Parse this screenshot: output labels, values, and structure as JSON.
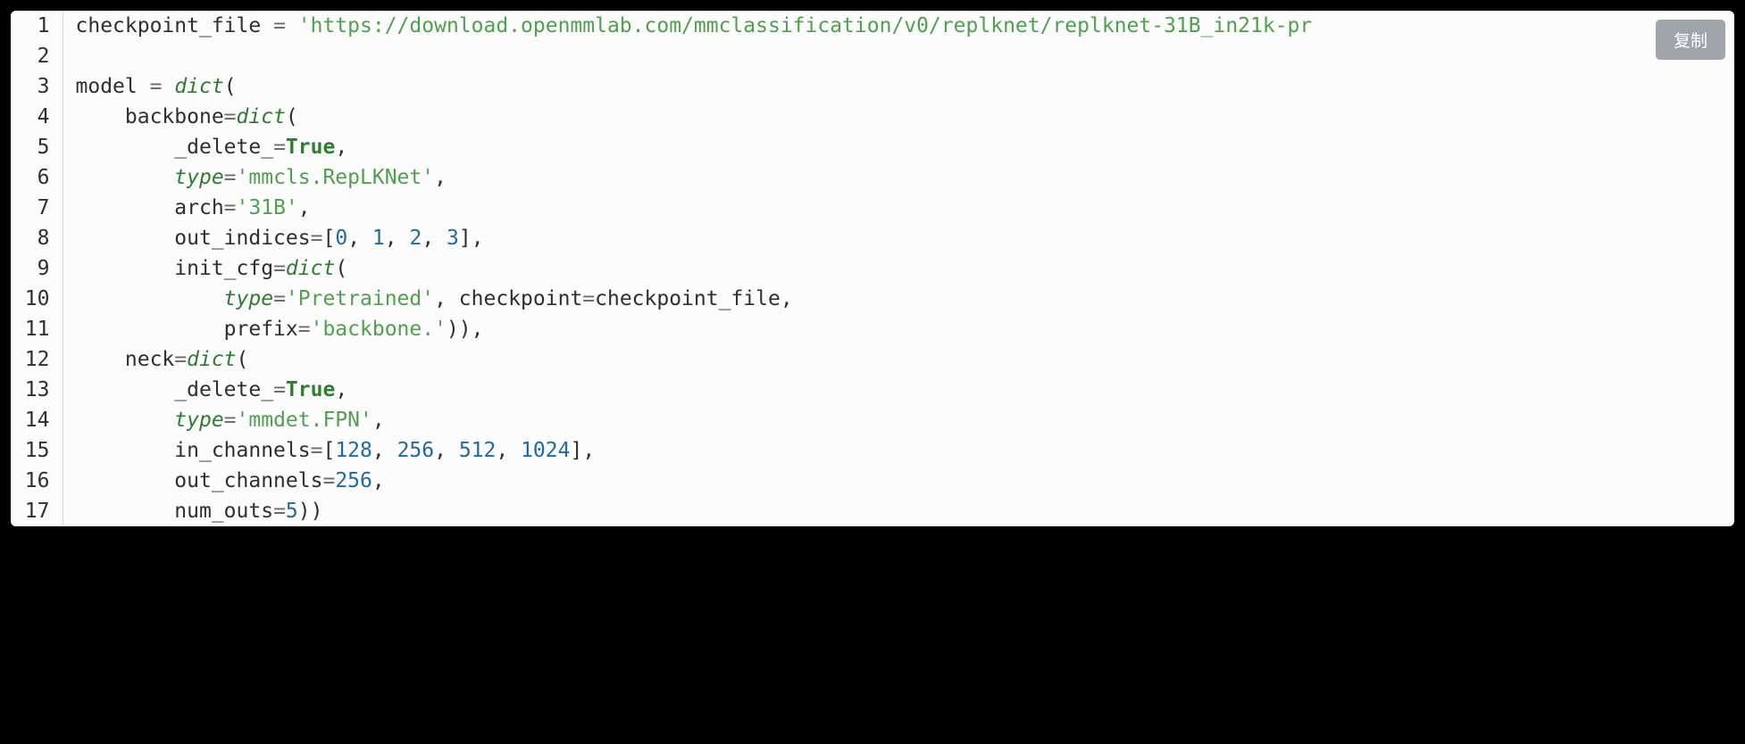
{
  "copy_button_label": "复制",
  "code": {
    "lines": [
      {
        "num": "1",
        "segments": [
          {
            "t": "checkpoint_file ",
            "c": "tok-name"
          },
          {
            "t": "=",
            "c": "tok-op"
          },
          {
            "t": " ",
            "c": ""
          },
          {
            "t": "'https://download.openmmlab.com/mmclassification/v0/replknet/replknet-31B_in21k-pr",
            "c": "tok-str"
          }
        ]
      },
      {
        "num": "2",
        "segments": [
          {
            "t": "",
            "c": ""
          }
        ]
      },
      {
        "num": "3",
        "segments": [
          {
            "t": "model ",
            "c": "tok-name"
          },
          {
            "t": "=",
            "c": "tok-op"
          },
          {
            "t": " ",
            "c": ""
          },
          {
            "t": "dict",
            "c": "tok-builtin"
          },
          {
            "t": "(",
            "c": "tok-punct"
          }
        ]
      },
      {
        "num": "4",
        "segments": [
          {
            "t": "    backbone",
            "c": "tok-name"
          },
          {
            "t": "=",
            "c": "tok-op"
          },
          {
            "t": "dict",
            "c": "tok-builtin"
          },
          {
            "t": "(",
            "c": "tok-punct"
          }
        ]
      },
      {
        "num": "5",
        "segments": [
          {
            "t": "        _delete_",
            "c": "tok-name"
          },
          {
            "t": "=",
            "c": "tok-op"
          },
          {
            "t": "True",
            "c": "tok-kw"
          },
          {
            "t": ",",
            "c": "tok-punct"
          }
        ]
      },
      {
        "num": "6",
        "segments": [
          {
            "t": "        ",
            "c": ""
          },
          {
            "t": "type",
            "c": "tok-builtin"
          },
          {
            "t": "=",
            "c": "tok-op"
          },
          {
            "t": "'mmcls.RepLKNet'",
            "c": "tok-str"
          },
          {
            "t": ",",
            "c": "tok-punct"
          }
        ]
      },
      {
        "num": "7",
        "segments": [
          {
            "t": "        arch",
            "c": "tok-name"
          },
          {
            "t": "=",
            "c": "tok-op"
          },
          {
            "t": "'31B'",
            "c": "tok-str"
          },
          {
            "t": ",",
            "c": "tok-punct"
          }
        ]
      },
      {
        "num": "8",
        "segments": [
          {
            "t": "        out_indices",
            "c": "tok-name"
          },
          {
            "t": "=",
            "c": "tok-op"
          },
          {
            "t": "[",
            "c": "tok-punct"
          },
          {
            "t": "0",
            "c": "tok-num"
          },
          {
            "t": ", ",
            "c": "tok-punct"
          },
          {
            "t": "1",
            "c": "tok-num"
          },
          {
            "t": ", ",
            "c": "tok-punct"
          },
          {
            "t": "2",
            "c": "tok-num"
          },
          {
            "t": ", ",
            "c": "tok-punct"
          },
          {
            "t": "3",
            "c": "tok-num"
          },
          {
            "t": "],",
            "c": "tok-punct"
          }
        ]
      },
      {
        "num": "9",
        "segments": [
          {
            "t": "        init_cfg",
            "c": "tok-name"
          },
          {
            "t": "=",
            "c": "tok-op"
          },
          {
            "t": "dict",
            "c": "tok-builtin"
          },
          {
            "t": "(",
            "c": "tok-punct"
          }
        ]
      },
      {
        "num": "10",
        "segments": [
          {
            "t": "            ",
            "c": ""
          },
          {
            "t": "type",
            "c": "tok-builtin"
          },
          {
            "t": "=",
            "c": "tok-op"
          },
          {
            "t": "'Pretrained'",
            "c": "tok-str"
          },
          {
            "t": ", checkpoint",
            "c": "tok-name"
          },
          {
            "t": "=",
            "c": "tok-op"
          },
          {
            "t": "checkpoint_file,",
            "c": "tok-name"
          }
        ]
      },
      {
        "num": "11",
        "segments": [
          {
            "t": "            prefix",
            "c": "tok-name"
          },
          {
            "t": "=",
            "c": "tok-op"
          },
          {
            "t": "'backbone.'",
            "c": "tok-str"
          },
          {
            "t": ")),",
            "c": "tok-punct"
          }
        ]
      },
      {
        "num": "12",
        "segments": [
          {
            "t": "    neck",
            "c": "tok-name"
          },
          {
            "t": "=",
            "c": "tok-op"
          },
          {
            "t": "dict",
            "c": "tok-builtin"
          },
          {
            "t": "(",
            "c": "tok-punct"
          }
        ]
      },
      {
        "num": "13",
        "segments": [
          {
            "t": "        _delete_",
            "c": "tok-name"
          },
          {
            "t": "=",
            "c": "tok-op"
          },
          {
            "t": "True",
            "c": "tok-kw"
          },
          {
            "t": ",",
            "c": "tok-punct"
          }
        ]
      },
      {
        "num": "14",
        "segments": [
          {
            "t": "        ",
            "c": ""
          },
          {
            "t": "type",
            "c": "tok-builtin"
          },
          {
            "t": "=",
            "c": "tok-op"
          },
          {
            "t": "'mmdet.FPN'",
            "c": "tok-str"
          },
          {
            "t": ",",
            "c": "tok-punct"
          }
        ]
      },
      {
        "num": "15",
        "segments": [
          {
            "t": "        in_channels",
            "c": "tok-name"
          },
          {
            "t": "=",
            "c": "tok-op"
          },
          {
            "t": "[",
            "c": "tok-punct"
          },
          {
            "t": "128",
            "c": "tok-num"
          },
          {
            "t": ", ",
            "c": "tok-punct"
          },
          {
            "t": "256",
            "c": "tok-num"
          },
          {
            "t": ", ",
            "c": "tok-punct"
          },
          {
            "t": "512",
            "c": "tok-num"
          },
          {
            "t": ", ",
            "c": "tok-punct"
          },
          {
            "t": "1024",
            "c": "tok-num"
          },
          {
            "t": "],",
            "c": "tok-punct"
          }
        ]
      },
      {
        "num": "16",
        "segments": [
          {
            "t": "        out_channels",
            "c": "tok-name"
          },
          {
            "t": "=",
            "c": "tok-op"
          },
          {
            "t": "256",
            "c": "tok-num"
          },
          {
            "t": ",",
            "c": "tok-punct"
          }
        ]
      },
      {
        "num": "17",
        "segments": [
          {
            "t": "        num_outs",
            "c": "tok-name"
          },
          {
            "t": "=",
            "c": "tok-op"
          },
          {
            "t": "5",
            "c": "tok-num"
          },
          {
            "t": "))",
            "c": "tok-punct"
          }
        ]
      }
    ]
  }
}
